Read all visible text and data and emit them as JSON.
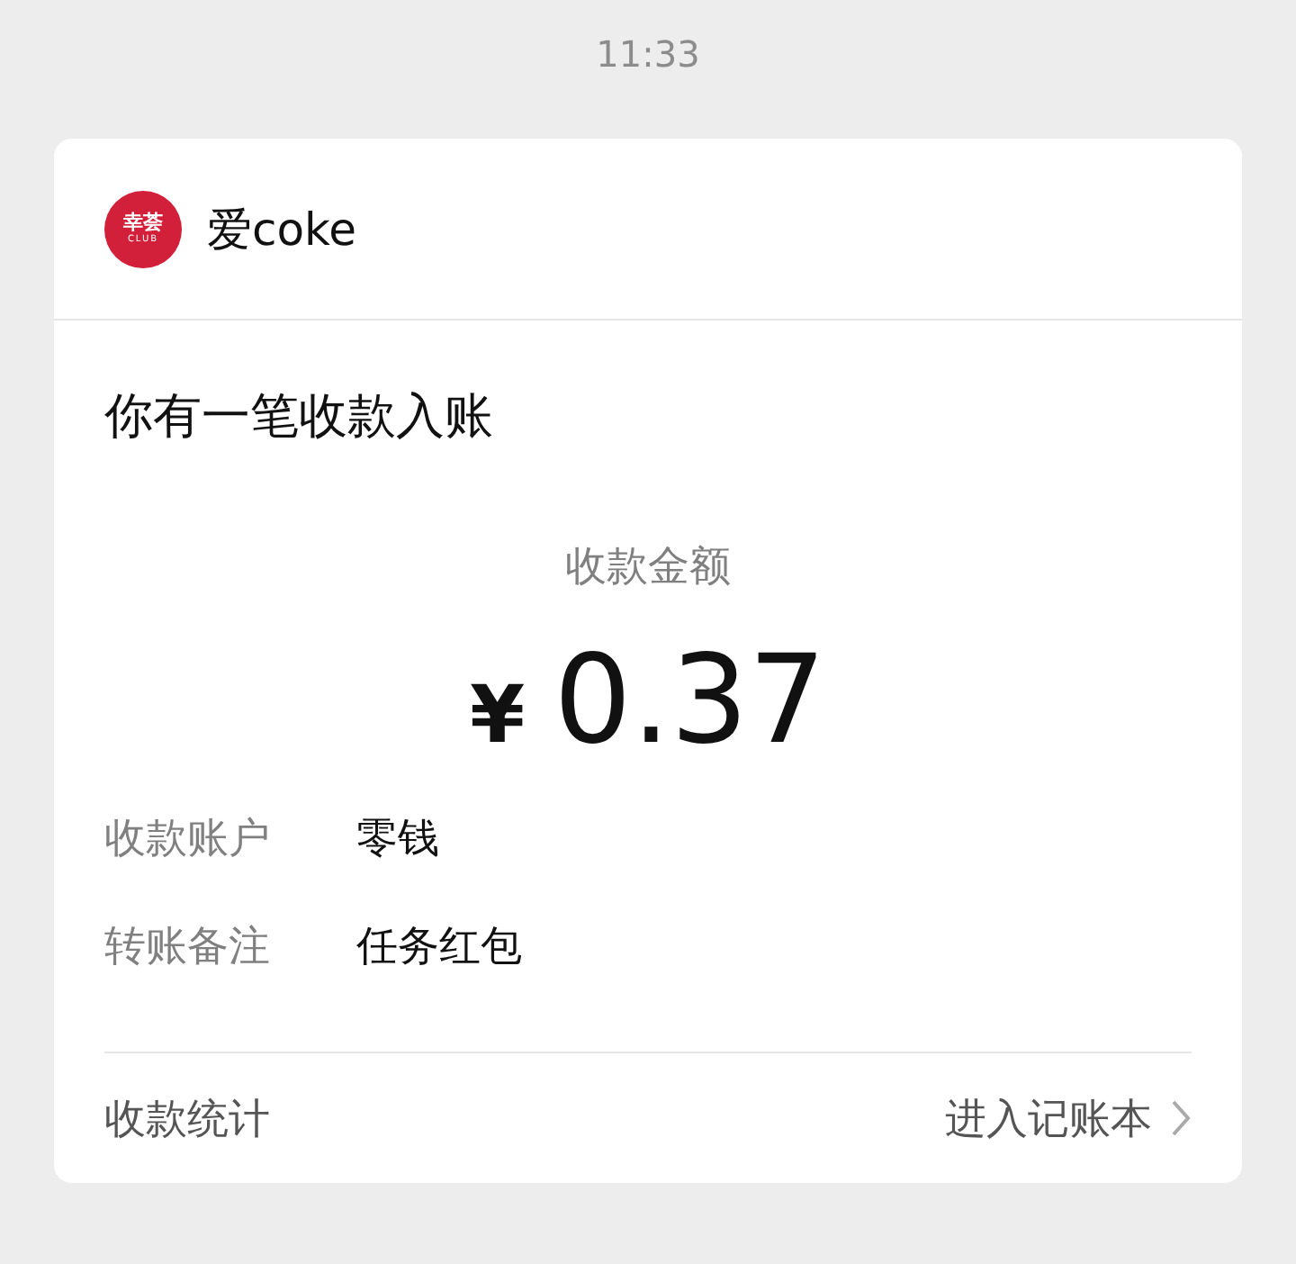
{
  "time": "11:33",
  "account": {
    "logo_line1": "幸荟",
    "logo_line2": "CLUB",
    "name": "爱coke"
  },
  "title": "你有一笔收款入账",
  "amount_label": "收款金额",
  "amount": {
    "currency": "¥",
    "value": "0.37"
  },
  "details": [
    {
      "label": "收款账户",
      "value": "零钱"
    },
    {
      "label": "转账备注",
      "value": "任务红包"
    }
  ],
  "footer": {
    "label": "收款统计",
    "link": "进入记账本"
  }
}
